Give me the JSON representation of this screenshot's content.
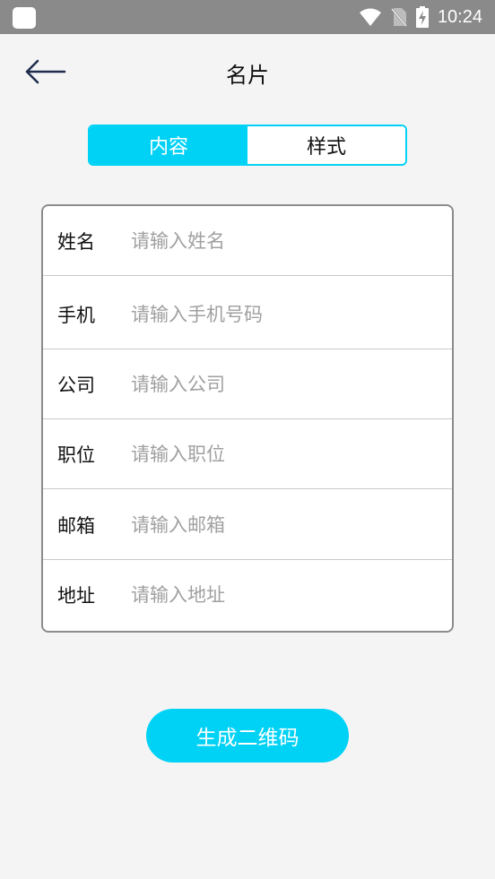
{
  "status_bar": {
    "time": "10:24",
    "icons": [
      "app-icon",
      "wifi-icon",
      "no-sim-icon",
      "battery-charging-icon"
    ]
  },
  "header": {
    "title": "名片",
    "back_icon": "arrow-left-icon"
  },
  "tabs": [
    {
      "label": "内容",
      "active": true
    },
    {
      "label": "样式",
      "active": false
    }
  ],
  "form": {
    "fields": [
      {
        "label": "姓名",
        "placeholder": "请输入姓名",
        "value": ""
      },
      {
        "label": "手机",
        "placeholder": "请输入手机号码",
        "value": ""
      },
      {
        "label": "公司",
        "placeholder": "请输入公司",
        "value": ""
      },
      {
        "label": "职位",
        "placeholder": "请输入职位",
        "value": ""
      },
      {
        "label": "邮箱",
        "placeholder": "请输入邮箱",
        "value": ""
      },
      {
        "label": "地址",
        "placeholder": "请输入地址",
        "value": ""
      }
    ]
  },
  "actions": {
    "generate_label": "生成二维码"
  },
  "colors": {
    "accent": "#00d2f6",
    "status_bar": "#8a8a8a",
    "background": "#f4f4f4",
    "card_border": "#8c8c8c",
    "placeholder": "#a0a0a0"
  }
}
